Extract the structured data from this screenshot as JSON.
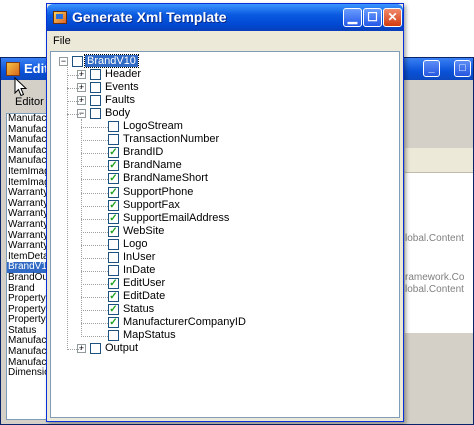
{
  "background_window": {
    "title": "Edito",
    "menu_label": "Editor",
    "list_items": [
      "Manufactu",
      "Manufactu",
      "Manufactu",
      "Manufactu",
      "Manufactu",
      "ItemImage",
      "ItemImage",
      "Warranty",
      "Warranty",
      "Warranty",
      "Warranty",
      "Warranty",
      "Warranty",
      "ItemDetail",
      "BrandV10",
      "BrandOutp",
      "Brand",
      "PropertyV",
      "PropertyV",
      "PropertyV",
      "Status",
      "Manufactu",
      "Manufactu",
      "Manufactu",
      "Dimension"
    ],
    "selected_item_index": 14,
    "right_panel_texts": [
      "lobal.Content",
      "ramework.Co",
      "lobal.Content"
    ]
  },
  "dialog": {
    "title": "Generate Xml Template",
    "menu": {
      "file": "File"
    },
    "controls": {
      "minimize": "▁",
      "maximize": "☐",
      "close": "✕"
    }
  },
  "tree": {
    "root": {
      "label": "BrandV10",
      "checked": false,
      "expanded": true,
      "selected": true
    },
    "sections": [
      {
        "label": "Header",
        "checked": false,
        "expanded": false
      },
      {
        "label": "Events",
        "checked": false,
        "expanded": false
      },
      {
        "label": "Faults",
        "checked": false,
        "expanded": false
      },
      {
        "label": "Body",
        "checked": false,
        "expanded": true
      }
    ],
    "body_items": [
      {
        "label": "LogoStream",
        "checked": false
      },
      {
        "label": "TransactionNumber",
        "checked": false
      },
      {
        "label": "BrandID",
        "checked": true
      },
      {
        "label": "BrandName",
        "checked": true
      },
      {
        "label": "BrandNameShort",
        "checked": true
      },
      {
        "label": "SupportPhone",
        "checked": true
      },
      {
        "label": "SupportFax",
        "checked": true
      },
      {
        "label": "SupportEmailAddress",
        "checked": true
      },
      {
        "label": "WebSite",
        "checked": true
      },
      {
        "label": "Logo",
        "checked": false
      },
      {
        "label": "InUser",
        "checked": false
      },
      {
        "label": "InDate",
        "checked": false
      },
      {
        "label": "EditUser",
        "checked": true
      },
      {
        "label": "EditDate",
        "checked": true
      },
      {
        "label": "Status",
        "checked": true
      },
      {
        "label": "ManufacturerCompanyID",
        "checked": true
      },
      {
        "label": "MapStatus",
        "checked": false
      }
    ],
    "after_body": {
      "label": "Output",
      "checked": false,
      "expanded": false
    }
  },
  "icons": {
    "check": "check-icon",
    "expand": "plus-icon",
    "collapse": "minus-icon",
    "cursor": "arrow-cursor-icon"
  }
}
